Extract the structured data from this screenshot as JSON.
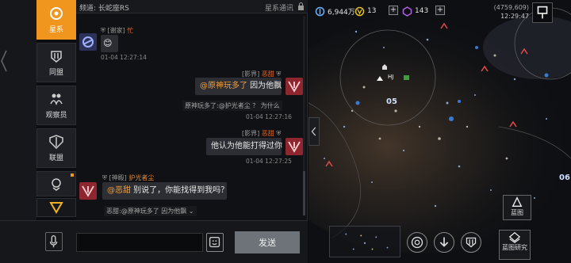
{
  "colors": {
    "accent": "#f0951e",
    "mention": "#f0a040",
    "name": "#e06a2a"
  },
  "sidebar": {
    "items": [
      {
        "label": "星系",
        "icon": "galaxy-target-icon",
        "active": true
      },
      {
        "label": "同盟",
        "icon": "alliance-icon"
      },
      {
        "label": "观察员",
        "icon": "observer-icon"
      },
      {
        "label": "联盟",
        "icon": "union-shield-icon"
      },
      {
        "label": "",
        "icon": "more-chevron-icon",
        "badge": true
      },
      {
        "label": "",
        "icon": "triangle-filter-icon"
      }
    ]
  },
  "chat": {
    "channel": "频道: 长蛇座RS",
    "galaxy_comm": "星系通讯",
    "messages": [
      {
        "tag": "[谢家]",
        "name": "忙",
        "text": "😊",
        "time": "01-04 12:27:14",
        "side": "left"
      },
      {
        "tag": "[影界]",
        "name": "恶甜",
        "mention": "@原神玩多了",
        "text": " 因为他飘",
        "quote": "原神玩多了:@护光者尘 ？ 为什么",
        "time": "01-04 12:27:16",
        "side": "right"
      },
      {
        "tag": "[影界]",
        "name": "恶甜",
        "text": "他认为他能打得过你",
        "time": "01-04 12:27:25",
        "side": "right"
      },
      {
        "tag": "[神殿]",
        "name": "护光者尘",
        "mention": "@恶甜",
        "text": " 别说了，你能找得到我吗？",
        "quote": "恶甜:@原神玩多了 因为他飘",
        "side": "left"
      }
    ]
  },
  "input": {
    "placeholder": "",
    "send_label": "发送"
  },
  "map": {
    "resources": [
      {
        "icon": "credits-icon",
        "value": "6,944万"
      },
      {
        "icon": "hydrogen-icon",
        "value": "13"
      },
      {
        "icon": "crystal-icon",
        "value": "143"
      }
    ],
    "coords": "(4759,609)",
    "clock": "12:29:47",
    "labels": [
      "05",
      "06"
    ],
    "station_tag": "HJ",
    "blueprint_label": "蓝图",
    "blueprint_research_label": "蓝图研究"
  }
}
